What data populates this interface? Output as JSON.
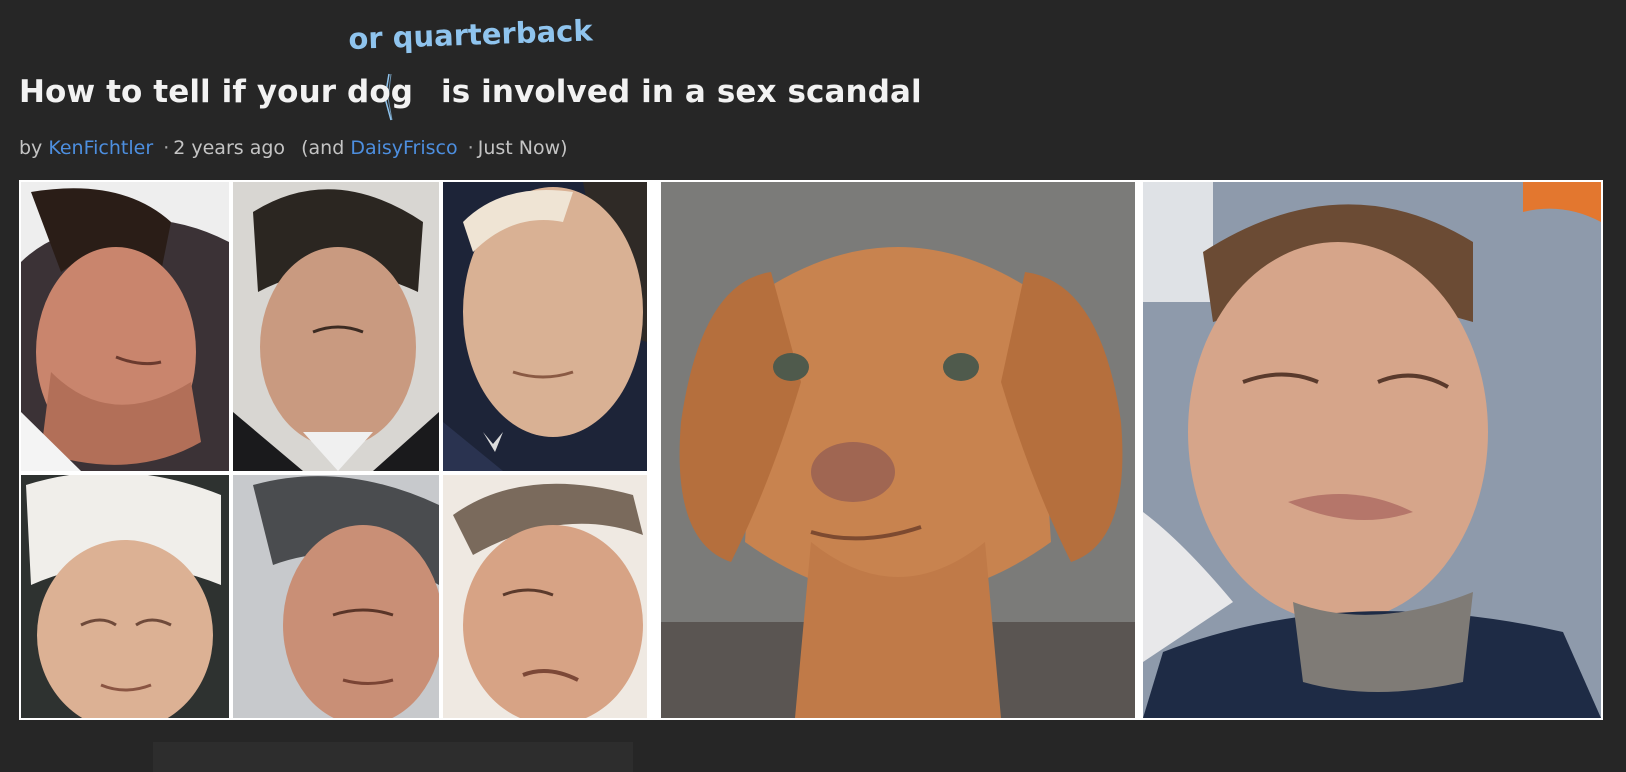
{
  "article": {
    "insertion": "or quarterback",
    "title_before": "How to tell if your dog",
    "title_after": "is involved in a sex scandal",
    "byline": {
      "by": "by",
      "author": "KenFichtler",
      "time": "2 years ago",
      "open_paren": "(and",
      "editor": "DaisyFrisco",
      "edit_time": "Just Now)"
    }
  },
  "images": [
    {
      "name": "photo-man-1",
      "alt": "man looking down"
    },
    {
      "name": "photo-man-2",
      "alt": "man looking down"
    },
    {
      "name": "photo-man-3",
      "alt": "man looking down"
    },
    {
      "name": "photo-man-4",
      "alt": "white-haired man looking down"
    },
    {
      "name": "photo-man-5",
      "alt": "gray-haired man looking down"
    },
    {
      "name": "photo-man-6",
      "alt": "balding man looking down"
    },
    {
      "name": "photo-puppy",
      "alt": "sad-faced puppy"
    },
    {
      "name": "photo-quarterback",
      "alt": "quarterback with pursed lips"
    }
  ],
  "colors": {
    "background": "#262626",
    "link": "#4d8fe0",
    "insertion": "#8fc4ee",
    "title": "#f2f2f2"
  }
}
